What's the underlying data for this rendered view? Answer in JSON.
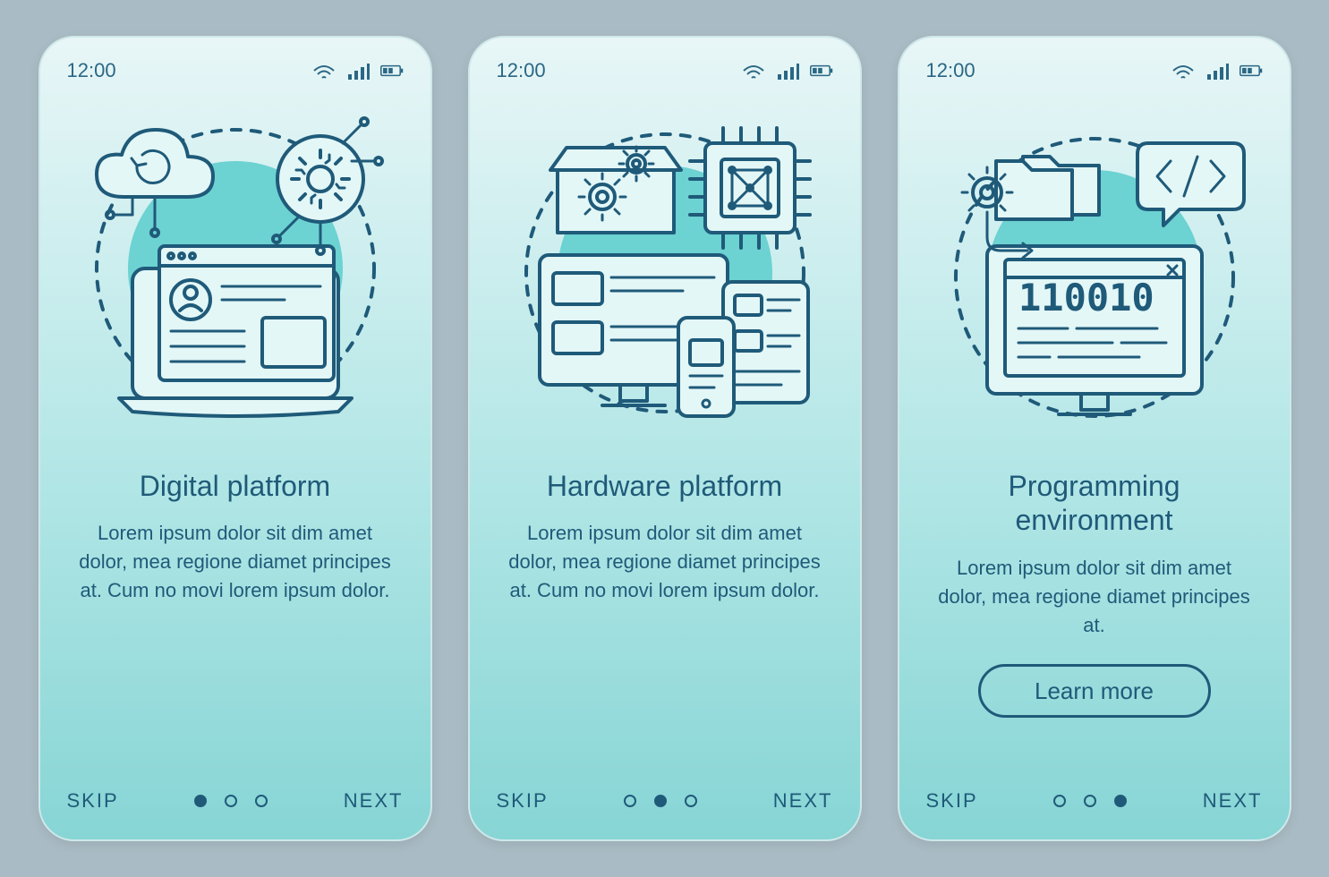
{
  "statusbar": {
    "time": "12:00",
    "wifi_icon": "wifi",
    "signal_icon": "signal",
    "battery_icon": "battery"
  },
  "screens": [
    {
      "title": "Digital platform",
      "description": "Lorem ipsum dolor sit dim amet dolor, mea regione diamet principes at. Cum no movi lorem ipsum dolor.",
      "illustration": "digital-platform",
      "skip_label": "SKIP",
      "next_label": "NEXT",
      "cta": null,
      "active_dot": 0,
      "dot_count": 3
    },
    {
      "title": "Hardware platform",
      "description": "Lorem ipsum dolor sit dim amet dolor, mea regione diamet principes at. Cum no movi lorem ipsum dolor.",
      "illustration": "hardware-platform",
      "skip_label": "SKIP",
      "next_label": "NEXT",
      "cta": null,
      "active_dot": 1,
      "dot_count": 3
    },
    {
      "title": "Programming environment",
      "description": "Lorem ipsum dolor sit dim amet dolor, mea regione diamet principes at.",
      "illustration": "programming-environment",
      "skip_label": "SKIP",
      "next_label": "NEXT",
      "cta": "Learn more",
      "active_dot": 2,
      "dot_count": 3
    }
  ],
  "colors": {
    "stroke": "#1f5a79",
    "teal": "#6cd2d2",
    "gradient_top": "#e8f6f7",
    "gradient_bottom": "#87d5d5",
    "page_bg": "#a9bbc4"
  }
}
